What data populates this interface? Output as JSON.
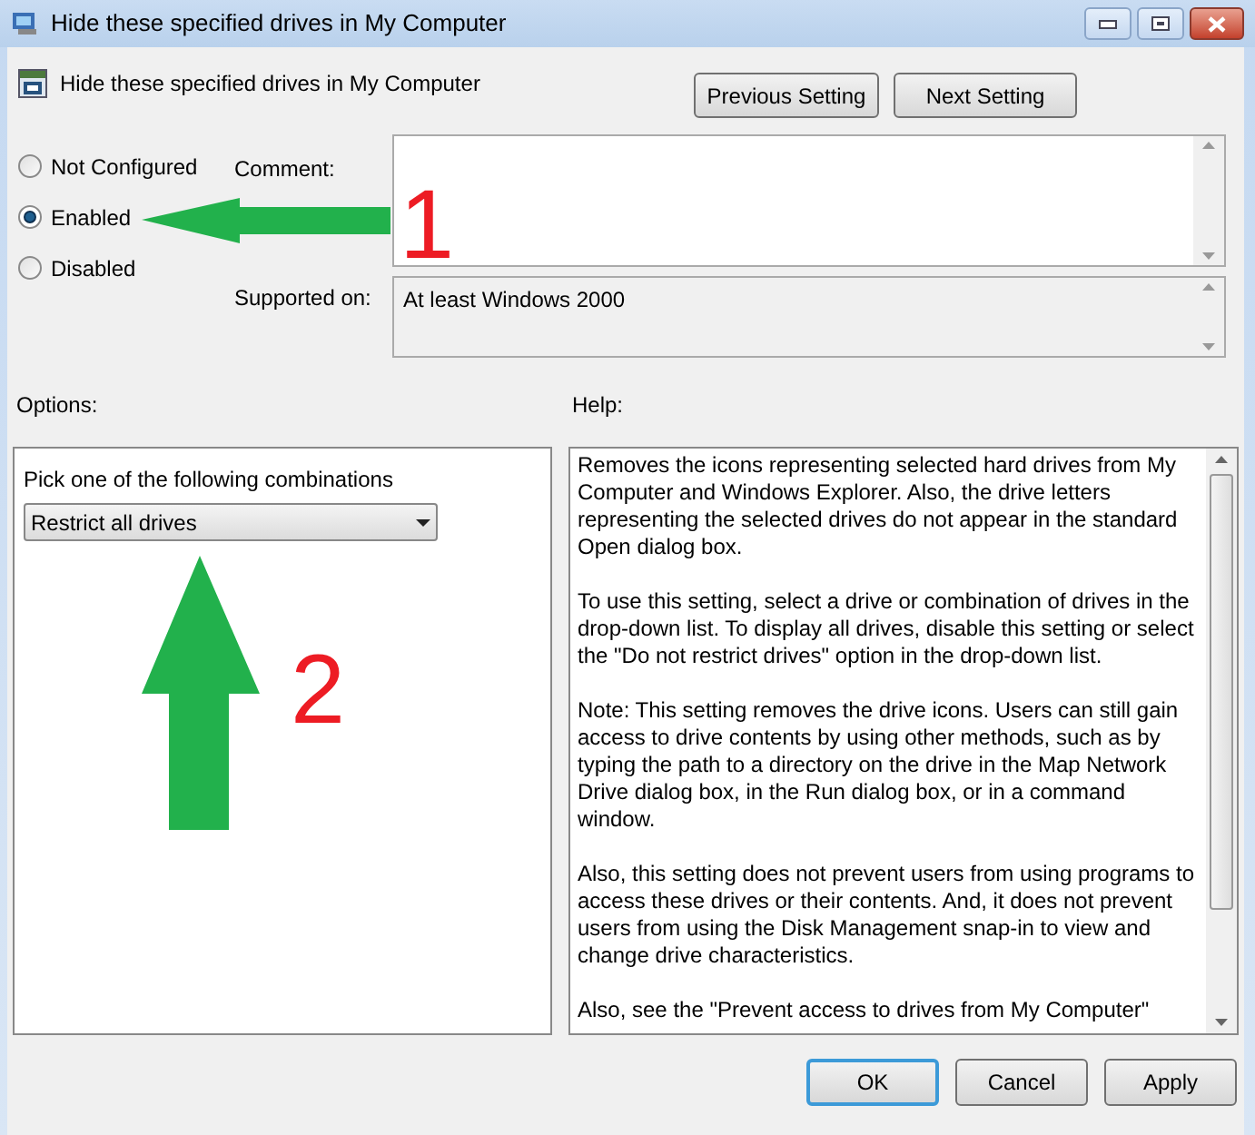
{
  "window": {
    "title": "Hide these specified drives in My Computer"
  },
  "header": {
    "title": "Hide these specified drives in My Computer"
  },
  "nav_buttons": [
    "Previous Setting",
    "Next Setting"
  ],
  "state_options": [
    {
      "label": "Not Configured",
      "selected": false
    },
    {
      "label": "Enabled",
      "selected": true
    },
    {
      "label": "Disabled",
      "selected": false
    }
  ],
  "comment": {
    "label": "Comment:"
  },
  "supported_on": {
    "label": "Supported on:",
    "value": "At least Windows 2000"
  },
  "options": {
    "label": "Options:",
    "prompt": "Pick one of the following combinations",
    "dropdown": "Restrict all drives"
  },
  "help": {
    "label": "Help:",
    "paragraphs": [
      "Removes the icons representing selected hard drives from My Computer and Windows Explorer. Also, the drive letters representing the selected drives do not appear in the standard Open dialog box.",
      "To use this setting, select a drive or combination of drives in the drop-down list. To display all drives, disable this setting or select the \"Do not restrict drives\" option in the drop-down list.",
      "Note: This setting removes the drive icons. Users can still gain access to drive contents by using other methods, such as by typing the path to a directory on the drive in the Map Network Drive dialog box, in the Run dialog box, or in a command window.",
      "Also, this setting does not prevent users from using programs to access these drives or their contents. And, it does not prevent users from using the Disk Management snap-in to view and change drive characteristics.",
      "Also, see the \"Prevent access to drives from My Computer\""
    ]
  },
  "buttons": [
    {
      "label": "OK",
      "default": true
    },
    {
      "label": "Cancel",
      "default": false
    },
    {
      "label": "Apply",
      "default": false
    }
  ],
  "annotations": [
    {
      "label": "1",
      "kind": "left"
    },
    {
      "label": "2",
      "kind": "up"
    }
  ]
}
